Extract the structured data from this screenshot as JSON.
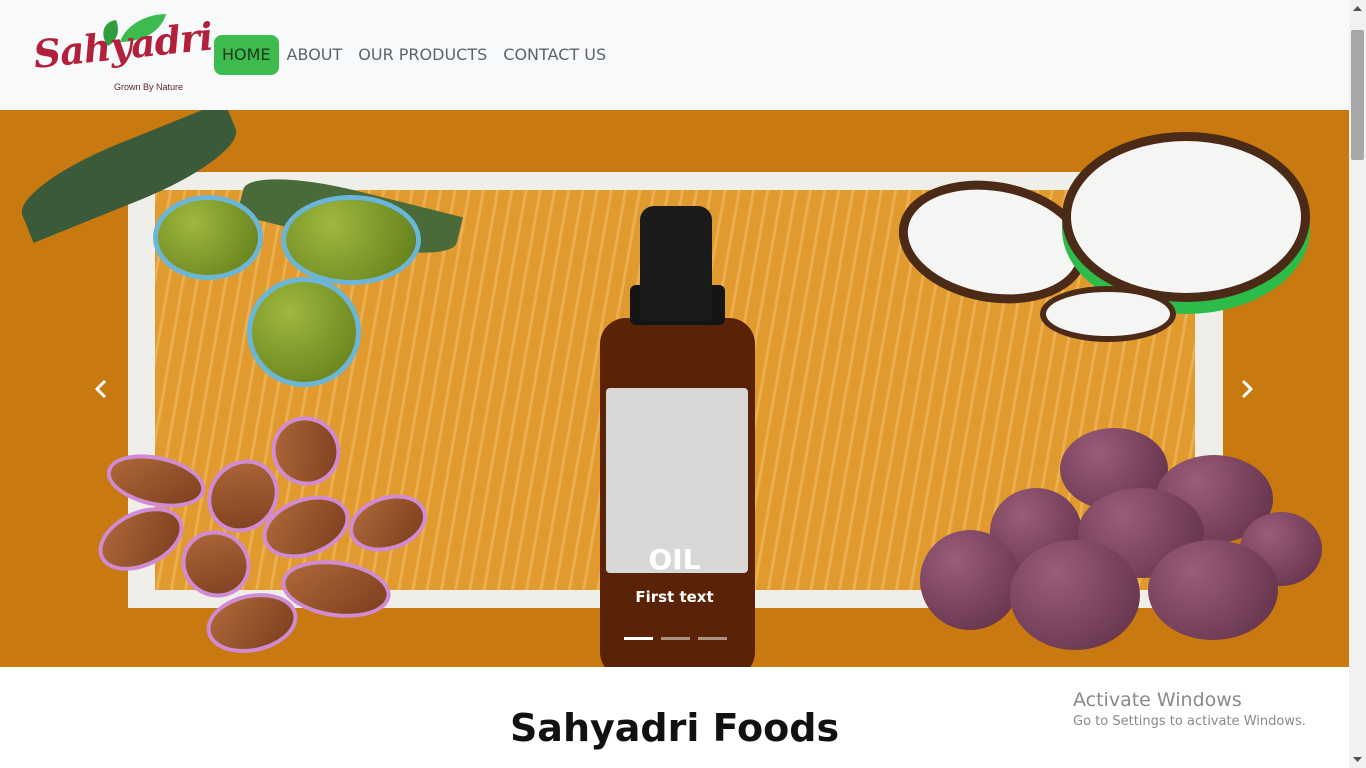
{
  "brand": {
    "name": "Sahyadri",
    "tagline": "Grown By Nature",
    "colors": {
      "primary": "#b3203c",
      "leaf": "#3dbb4e"
    }
  },
  "nav": {
    "items": [
      {
        "label": "HOME",
        "active": true
      },
      {
        "label": "ABOUT",
        "active": false
      },
      {
        "label": "OUR PRODUCTS",
        "active": false
      },
      {
        "label": "CONTACT US",
        "active": false
      }
    ],
    "active_color": "#3dbb4e"
  },
  "carousel": {
    "caption_title": "OIL",
    "caption_text": "First text",
    "slide_count": 3,
    "active_slide": 1,
    "prev_icon": "chevron-left-icon",
    "next_icon": "chevron-right-icon",
    "background_color": "#c87a10"
  },
  "main": {
    "heading": "Sahyadri Foods"
  },
  "windows_watermark": {
    "title": "Activate Windows",
    "subtitle": "Go to Settings to activate Windows."
  }
}
